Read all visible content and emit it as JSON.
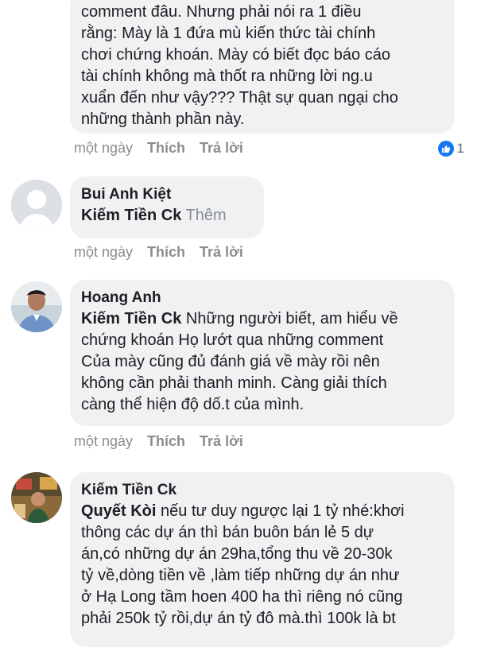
{
  "comments": [
    {
      "text_lines": [
        "comment đâu. Nhưng phải nói ra 1 điều",
        "rằng: Mày là 1 đứa mù kiến thức tài chính",
        "chơi chứng khoán. Mày có biết đọc báo cáo",
        "tài chính không mà thốt ra những lời ng.u",
        "xuẩn đến như vậy??? Thật sự quan ngại cho",
        "những thành phần này."
      ],
      "time": "một ngày",
      "like_label": "Thích",
      "reply_label": "Trả lời",
      "reaction_count": "1"
    },
    {
      "author": "Bui Anh Kiệt",
      "tag": "Kiếm Tiền Ck",
      "more_label": "Thêm",
      "time": "một ngày",
      "like_label": "Thích",
      "reply_label": "Trả lời"
    },
    {
      "author": "Hoang Anh",
      "tag": "Kiếm Tiền Ck",
      "text_first": "Những người biết, am hiểu về",
      "text_lines": [
        "chứng khoán Họ lướt qua những comment",
        "Của mày cũng đủ đánh giá về mày rồi nên",
        "không cần phải thanh minh. Càng giải thích",
        "càng thể hiện độ dố.t của mình."
      ],
      "time": "một ngày",
      "like_label": "Thích",
      "reply_label": "Trả lời"
    },
    {
      "author": "Kiếm Tiền Ck",
      "tag": "Quyết Kòi",
      "text_first": "nếu tư duy ngược lại 1 tỷ nhé:khơi",
      "text_lines": [
        "thông các dự án thì bán buôn bán lẻ 5 dự",
        "án,có những dự án 29ha,tổng thu về 20-30k",
        "tỷ về,dòng tiền về ,làm tiếp những dự án như",
        "ở Hạ Long tầm hoen 400 ha thì riêng nó cũng",
        "phải 250k tỷ rồi,dự án tỷ đô mà.thì 100k là bt"
      ]
    }
  ],
  "colors": {
    "bubble": "#eff1f3",
    "meta": "#8a8d91",
    "like_blue": "#1877f2"
  }
}
